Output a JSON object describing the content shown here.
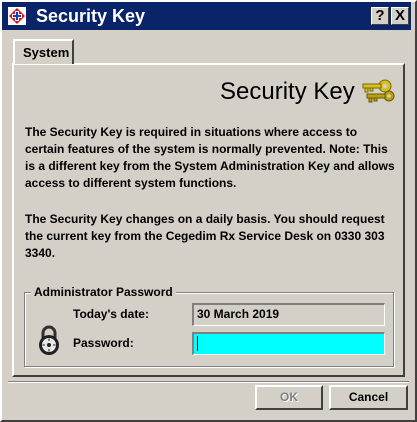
{
  "window": {
    "title": "Security Key",
    "title_buttons": {
      "help": "?",
      "close": "X"
    },
    "app_icon": "cegedim-logo-icon"
  },
  "tabs": [
    {
      "label": "System",
      "selected": true
    }
  ],
  "header": {
    "title": "Security Key",
    "icon": "keys-icon"
  },
  "body": {
    "paragraph1": "The Security Key is required in situations where access to certain features of the system is normally prevented. Note: This is a different key from the System Administration Key and allows access to different system functions.",
    "paragraph2": "The Security Key changes on a daily basis. You should request the current key from the Cegedim Rx Service Desk on 0330 303 3340."
  },
  "admin_group": {
    "legend": "Administrator Password",
    "date_label": "Today's date:",
    "date_value": "30 March 2019",
    "password_label": "Password:",
    "password_value": "",
    "lock_icon": "padlock-icon"
  },
  "buttons": {
    "ok": "OK",
    "cancel": "Cancel"
  },
  "colors": {
    "titlebar": "#0a246a",
    "password_field": "#00ffff",
    "face": "#d4d0c8"
  }
}
